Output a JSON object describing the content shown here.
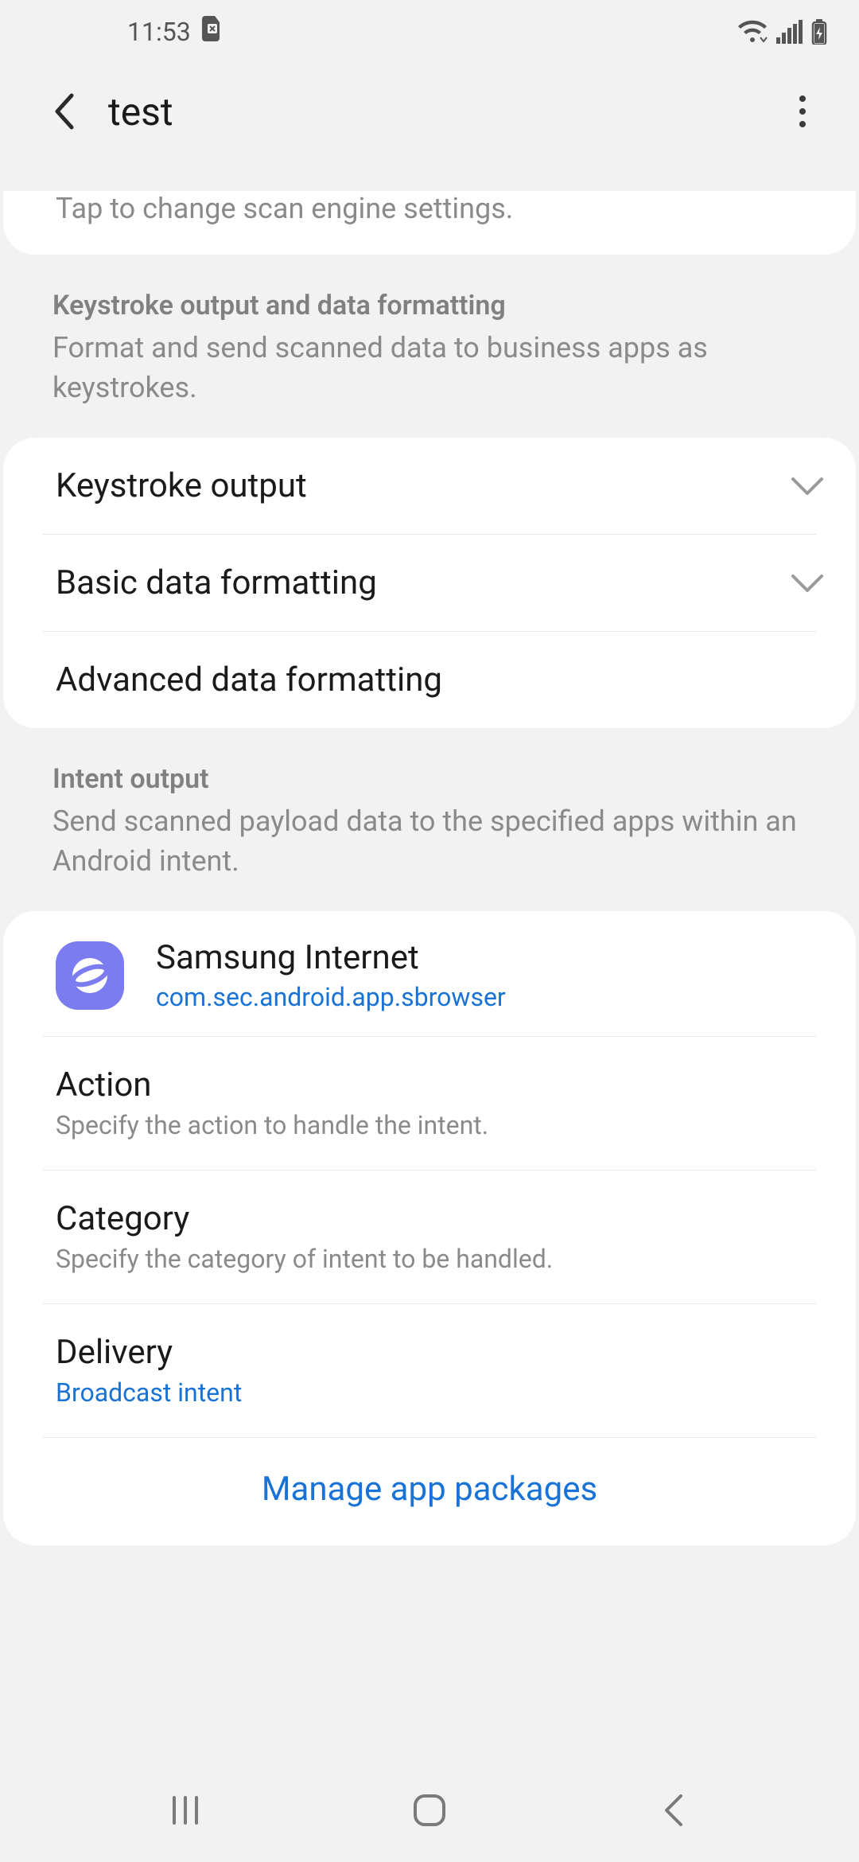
{
  "status": {
    "time": "11:53"
  },
  "header": {
    "title": "test"
  },
  "scan_engine_hint": "Tap to change scan engine settings.",
  "section_keystroke": {
    "title": "Keystroke output and data formatting",
    "desc": "Format and send scanned data to business apps as keystrokes.",
    "rows": {
      "keystroke_output": "Keystroke output",
      "basic_formatting": "Basic data formatting",
      "advanced_formatting": "Advanced data formatting"
    }
  },
  "section_intent": {
    "title": "Intent output",
    "desc": "Send scanned payload data to the specified apps within an Android intent.",
    "app": {
      "name": "Samsung Internet",
      "package": "com.sec.android.app.sbrowser"
    },
    "action": {
      "title": "Action",
      "desc": "Specify the action to handle the intent."
    },
    "category": {
      "title": "Category",
      "desc": "Specify the category of intent to be handled."
    },
    "delivery": {
      "title": "Delivery",
      "value": "Broadcast intent"
    },
    "manage": "Manage app packages"
  }
}
